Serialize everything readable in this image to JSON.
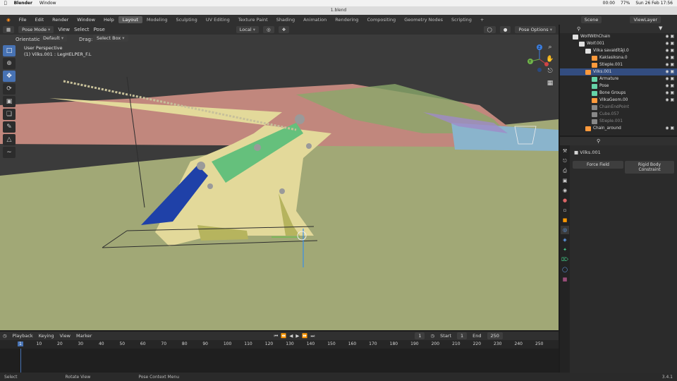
{
  "macbar": {
    "apple": "",
    "app": "Blender",
    "menu": "Window",
    "status": "00:00",
    "battery": "77%",
    "datetime": "Sun 26 Feb 17:56"
  },
  "window_title": "1.blend",
  "topbar": {
    "menus": [
      "File",
      "Edit",
      "Render",
      "Window",
      "Help"
    ],
    "workspaces": [
      "Layout",
      "Modeling",
      "Sculpting",
      "UV Editing",
      "Texture Paint",
      "Shading",
      "Animation",
      "Rendering",
      "Compositing",
      "Geometry Nodes",
      "Scripting"
    ],
    "add": "+",
    "scene": "Scene",
    "view_layer": "ViewLayer"
  },
  "viewport_header": {
    "mode": "Pose Mode",
    "menus": [
      "View",
      "Select",
      "Pose"
    ],
    "transform": "Local",
    "pose_options": "Pose Options"
  },
  "viewport_sub": {
    "orientation_label": "Orientation:",
    "orientation": "Default",
    "drag_label": "Drag:",
    "drag": "Select Box"
  },
  "viewport": {
    "view_name": "User Perspective",
    "object_name": "(1) Vilks.001 : LegHELPER_F.L"
  },
  "gizmo": {
    "z": "Z",
    "y": "Y",
    "x": "X"
  },
  "toolbar_icons": [
    "cursor-select-icon",
    "cursor-icon",
    "move-icon",
    "rotate-icon",
    "scale-icon",
    "transform-icon",
    "annotate-icon",
    "measure-icon",
    "relax-icon"
  ],
  "outliner": {
    "rows": [
      {
        "label": "WolfWithChain",
        "indent": 2,
        "color": "#e0e0e0",
        "dim": false,
        "sel": false
      },
      {
        "label": "Wolf.001",
        "indent": 3,
        "color": "#e0e0e0",
        "dim": false,
        "sel": false
      },
      {
        "label": "Vilka savaldītāji.0",
        "indent": 4,
        "color": "#e0e0e0",
        "dim": false,
        "sel": false
      },
      {
        "label": "Kaklasiksna.0",
        "indent": 5,
        "color": "#ff9a3c",
        "dim": false,
        "sel": false
      },
      {
        "label": "Stieple.001",
        "indent": 5,
        "color": "#ff9a3c",
        "dim": false,
        "sel": false
      },
      {
        "label": "Vilks.001",
        "indent": 4,
        "color": "#ff9a3c",
        "dim": false,
        "sel": true
      },
      {
        "label": "Armature",
        "indent": 5,
        "color": "#65d3a8",
        "dim": false,
        "sel": false
      },
      {
        "label": "Pose",
        "indent": 5,
        "color": "#65d3a8",
        "dim": false,
        "sel": false
      },
      {
        "label": "Bone Groups",
        "indent": 5,
        "color": "#65d3a8",
        "dim": false,
        "sel": false
      },
      {
        "label": "VilkaGeom.00",
        "indent": 5,
        "color": "#ff9a3c",
        "dim": false,
        "sel": false
      },
      {
        "label": "ChainEndPoint",
        "indent": 5,
        "color": "#888",
        "dim": true,
        "sel": false
      },
      {
        "label": "Cube.057",
        "indent": 5,
        "color": "#888",
        "dim": true,
        "sel": false
      },
      {
        "label": "Stieple.001",
        "indent": 5,
        "color": "#888",
        "dim": true,
        "sel": false
      },
      {
        "label": "Chain_around",
        "indent": 4,
        "color": "#ff9a3c",
        "dim": false,
        "sel": false
      }
    ]
  },
  "properties": {
    "object": "Vilks.001",
    "buttons": [
      "Force Field",
      "Rigid Body Constraint"
    ]
  },
  "timeline": {
    "menus": [
      "Playback",
      "Keying",
      "View",
      "Marker"
    ],
    "current_frame": "1",
    "start_label": "Start",
    "start": "1",
    "end_label": "End",
    "end": "250",
    "ticks": [
      "1",
      "10",
      "20",
      "30",
      "40",
      "50",
      "60",
      "70",
      "80",
      "90",
      "100",
      "110",
      "120",
      "130",
      "140",
      "150",
      "160",
      "170",
      "180",
      "190",
      "200",
      "210",
      "220",
      "230",
      "240",
      "250"
    ]
  },
  "status": {
    "items": [
      "Select",
      "Rotate View",
      "Pose Context Menu"
    ],
    "version": "3.4.1"
  }
}
